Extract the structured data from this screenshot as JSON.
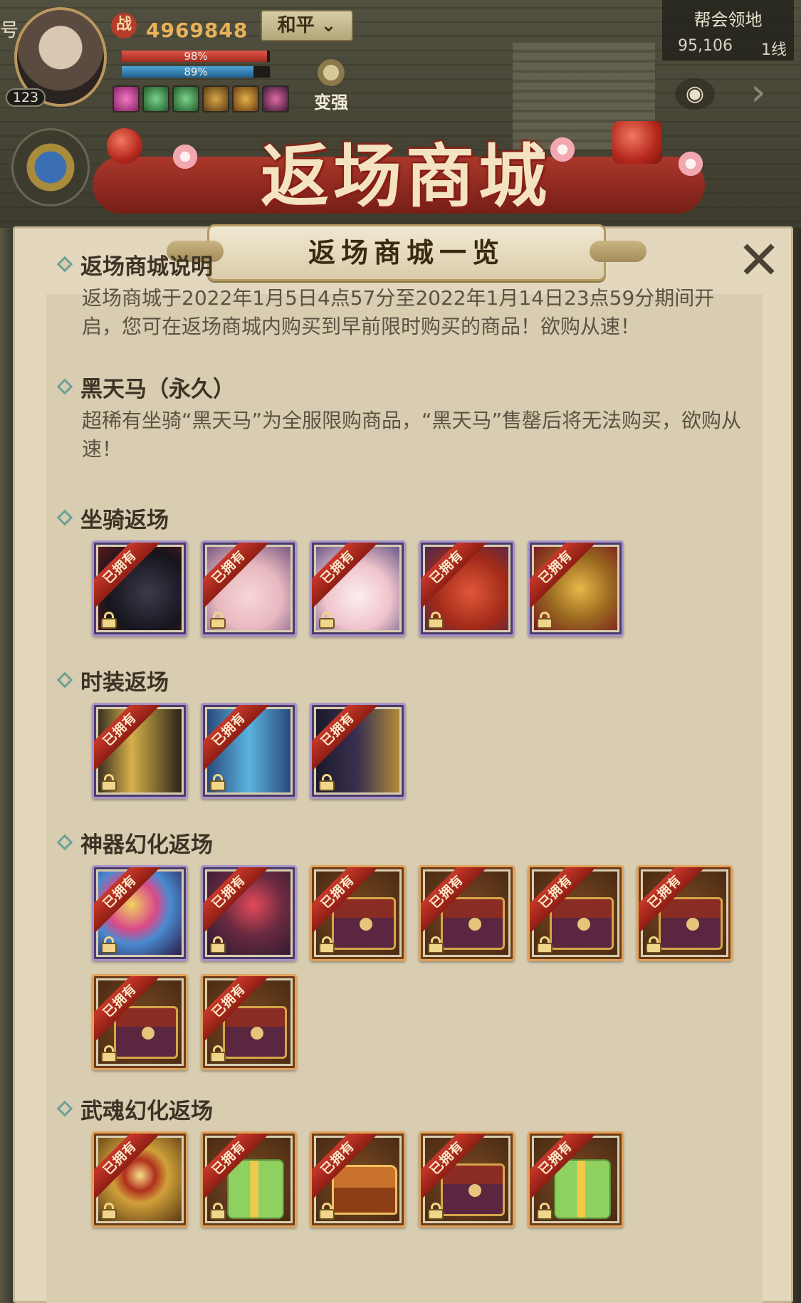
{
  "hud": {
    "corner_text": "号",
    "level": "123",
    "power_icon": "战",
    "power_value": "4969848",
    "hp_percent": "98%",
    "mp_percent": "89%",
    "hp_fill": 0.98,
    "mp_fill": 0.89,
    "mode": "和平",
    "strengthen_label": "变强",
    "territory": {
      "title": "帮会领地",
      "count": "95,106",
      "line": "1线"
    }
  },
  "banner": {
    "title": "返场商城"
  },
  "panel": {
    "title": "返场商城一览",
    "close_symbol": "✕",
    "owned_label": "已拥有",
    "sections": {
      "intro": {
        "title": "返场商城说明",
        "desc": "返场商城于2022年1月5日4点57分至2022年1月14日23点59分期间开启，您可在返场商城内购买到早前限时购买的商品！欲购从速！"
      },
      "horse": {
        "title": "黑天马（永久）",
        "desc": "超稀有坐骑“黑天马”为全服限购商品，“黑天马”售罄后将无法购买，欲购从速！"
      },
      "mounts": {
        "title": "坐骑返场"
      },
      "fashion": {
        "title": "时装返场"
      },
      "artifact": {
        "title": "神器幻化返场"
      },
      "soul": {
        "title": "武魂幻化返场"
      }
    }
  },
  "colors": {
    "panel_bg": "#e3d8bd",
    "purple_frame": "#a894c8",
    "orange_frame": "#e1a25a",
    "ribbon_red": "#c8382a",
    "diamond_teal": "#6aa296"
  },
  "icons": [
    "eye-icon",
    "arrow-right-icon",
    "close-icon",
    "lock-icon",
    "diamond-bullet-icon"
  ]
}
